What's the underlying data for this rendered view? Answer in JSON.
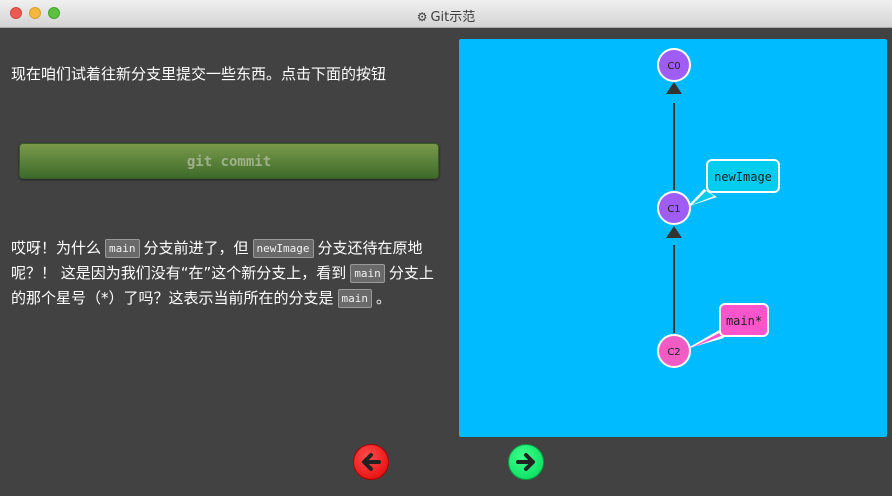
{
  "window": {
    "title": "Git示范"
  },
  "left": {
    "intro": "现在咱们试着往新分支里提交一些东西。点击下面的按钮",
    "commit_button": "git commit",
    "p2": {
      "t1": "哎呀！为什么",
      "c1": "main",
      "t2": "分支前进了，但",
      "c2": "newImage",
      "t3": "分支还待在原地呢？！ 这是因为我们没有“在”这个新分支上，看到",
      "c3": "main",
      "t4": "分支上的那个星号（*）了吗？这表示当前所在的分支是",
      "c4": "main",
      "t5": "。"
    }
  },
  "graph": {
    "commits": [
      "C0",
      "C1",
      "C2"
    ],
    "branches": [
      "newImage",
      "main*"
    ]
  },
  "colors": {
    "background": "#424242",
    "viz_bg": "#00bbff",
    "commit": "#a05cf6",
    "commit_head": "#f05cc4",
    "branch_newImage": "#00ccee",
    "branch_main": "#ff55cc"
  },
  "icons": {
    "back": "back-arrow-icon",
    "forward": "forward-arrow-icon"
  }
}
